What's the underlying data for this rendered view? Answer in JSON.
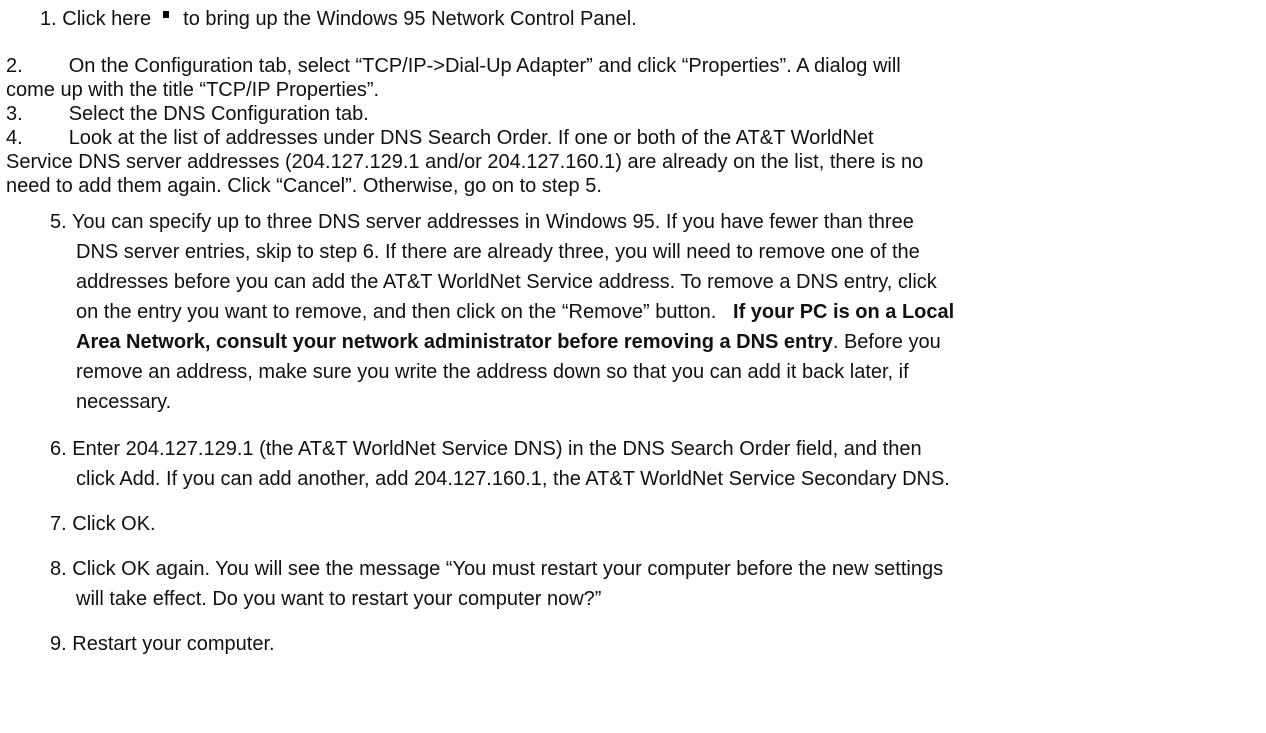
{
  "steps": {
    "s1": {
      "num": "1.",
      "pre": "Click here",
      "icon": "network-control-panel-link-icon",
      "post": "to bring up the Windows 95 Network Control Panel."
    },
    "s2": {
      "num": "2.",
      "line1": "On the Configuration tab, select “TCP/IP->Dial-Up Adapter” and click “Properties”.   A dialog will",
      "line2": "come up with the title “TCP/IP Properties”."
    },
    "s3": {
      "num": "3.",
      "line1": "Select the DNS Configuration tab."
    },
    "s4": {
      "num": "4.",
      "line1": "Look at the list of addresses under DNS Search Order.   If one or both of the AT&T WorldNet",
      "line2": "Service DNS server addresses (204.127.129.1 and/or 204.127.160.1) are already on the list, there is no",
      "line3": "need to add them again.   Click “Cancel”.   Otherwise, go on to step 5."
    },
    "s5": {
      "num": "5.",
      "line1": "You can specify up to three DNS server addresses in Windows 95.   If you have fewer than three",
      "line2": "DNS server entries, skip to step 6.   If there are already three, you will need to remove one of the",
      "line3": "addresses before you can add the AT&T WorldNet Service address. To remove a DNS entry, click",
      "line4_pre": "on the entry you want to remove, and then click on the “Remove” button.",
      "line4_bold": "If your PC is on a Local",
      "line5_bold": "Area Network, consult your network administrator before removing a DNS entry",
      "line5_post": ".   Before you",
      "line6": "remove an address, make sure you write the address down so that you can add it back later, if",
      "line7": "necessary."
    },
    "s6": {
      "num": "6.",
      "line1": "Enter 204.127.129.1 (the AT&T WorldNet Service DNS) in the DNS Search Order field, and then",
      "line2": "click Add.   If you can add another, add 204.127.160.1, the AT&T WorldNet Service Secondary DNS."
    },
    "s7": {
      "num": "7.",
      "line1": "Click OK."
    },
    "s8": {
      "num": "8.",
      "line1": "Click OK again.   You will see the message “You must restart your computer before the new settings",
      "line2": "will take effect.   Do you want to restart your computer now?”"
    },
    "s9": {
      "num": "9.",
      "line1": "Restart your computer."
    }
  }
}
